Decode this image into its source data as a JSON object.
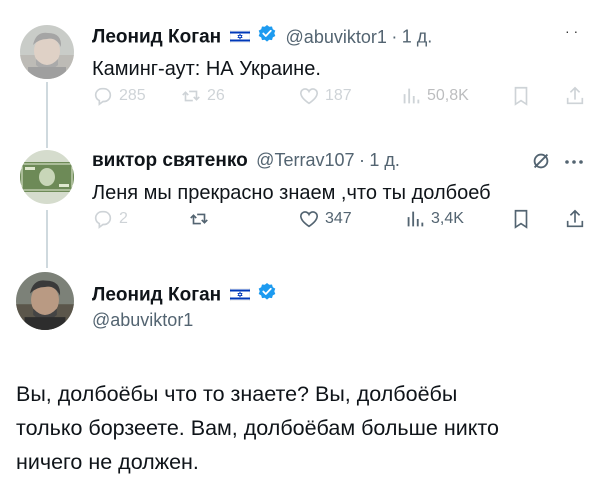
{
  "tweet1": {
    "name": "Леонид Коган",
    "handle": "@abuviktor1",
    "sep": "·",
    "time": "1 д.",
    "text": "Каминг-аут: НА Украине.",
    "replies": "285",
    "retweets": "26",
    "likes": "187",
    "views": "50,8K"
  },
  "tweet2": {
    "name": "виктор святенко",
    "handle": "@Terrav107",
    "sep": "·",
    "time": "1 д.",
    "text": "Леня мы прекрасно знаем ,что ты долбоеб",
    "replies": "2",
    "retweets": "",
    "likes": "347",
    "views": "3,4K"
  },
  "tweet3": {
    "name": "Леонид Коган",
    "handle": "@abuviktor1",
    "text_line1": "Вы, долбоёбы что то знаете? Вы, долбоёбы",
    "text_line2": "только борзеете. Вам, долбоёбам больше никто",
    "text_line3": "ничего не должен."
  },
  "colors": {
    "verified": "#1d9bf0",
    "text": "#0f1419",
    "muted": "#536471",
    "israel_blue": "#0038b8"
  }
}
